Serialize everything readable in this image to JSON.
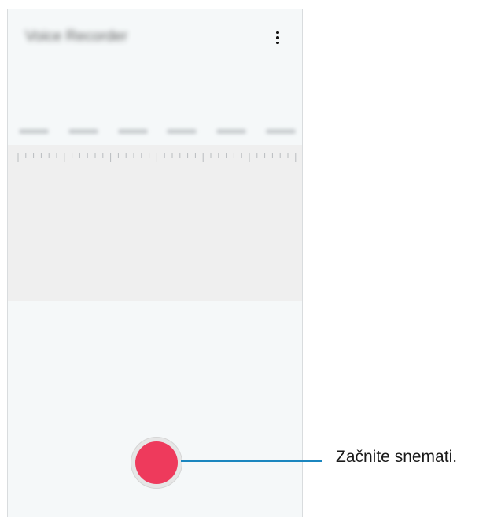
{
  "app": {
    "title": "Voice Recorder"
  },
  "callout": {
    "text": "Začnite snemati."
  },
  "colors": {
    "record_button": "#ee3a5c",
    "callout_line": "#1b86bf",
    "background": "#f5f8f9",
    "wave_area": "#efefef"
  },
  "icons": {
    "menu": "more-vertical-icon",
    "record": "record-icon"
  }
}
